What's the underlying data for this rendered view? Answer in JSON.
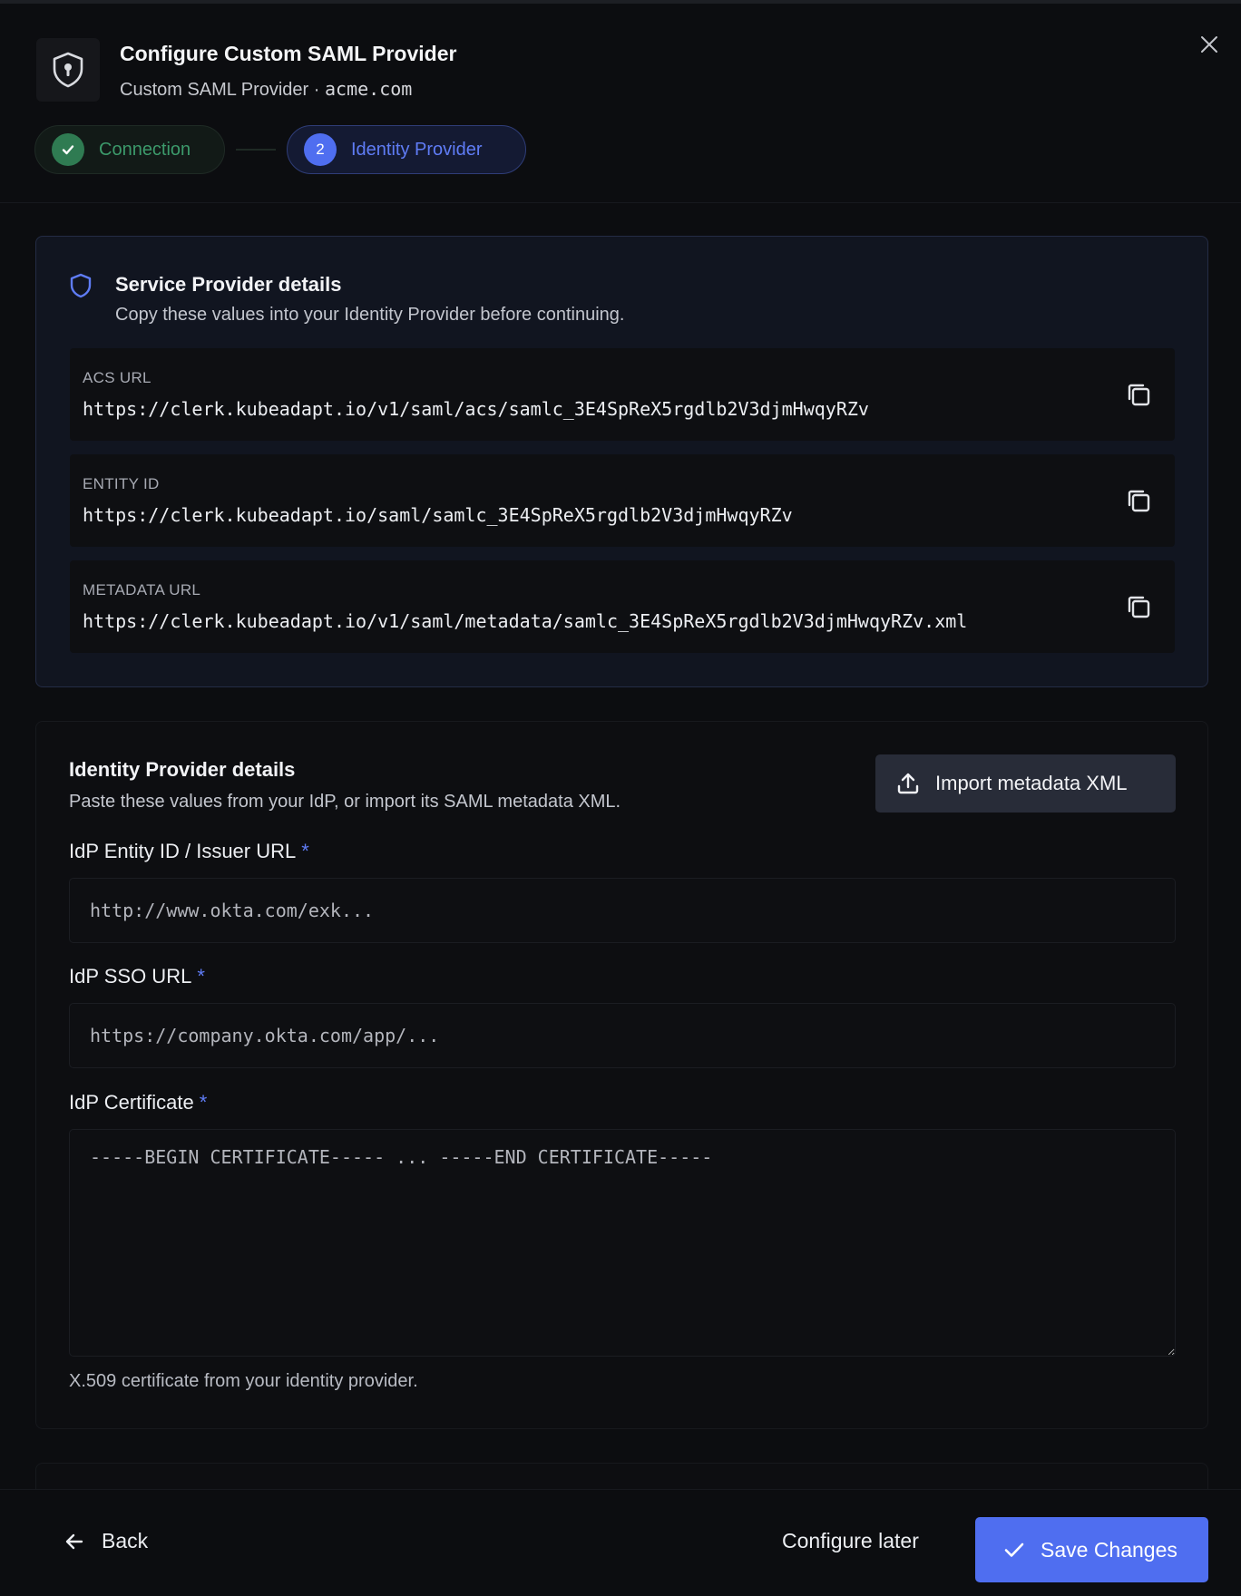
{
  "header": {
    "title": "Configure Custom SAML Provider",
    "subtitle_prefix": "Custom SAML Provider · ",
    "domain": "acme.com",
    "logo_icon": "shield-keyhole-icon",
    "close_icon": "close-icon"
  },
  "steps": [
    {
      "label": "Connection",
      "status": "complete",
      "icon": "check-icon"
    },
    {
      "number": "2",
      "label": "Identity Provider",
      "status": "active"
    }
  ],
  "service_provider": {
    "title": "Service Provider details",
    "description": "Copy these values into your Identity Provider before continuing.",
    "icon": "shield-icon",
    "rows": [
      {
        "label": "ACS URL",
        "value": "https://clerk.kubeadapt.io/v1/saml/acs/samlc_3E4SpReX5rgdlb2V3djmHwqyRZv"
      },
      {
        "label": "ENTITY ID",
        "value": "https://clerk.kubeadapt.io/saml/samlc_3E4SpReX5rgdlb2V3djmHwqyRZv"
      },
      {
        "label": "METADATA URL",
        "value": "https://clerk.kubeadapt.io/v1/saml/metadata/samlc_3E4SpReX5rgdlb2V3djmHwqyRZv.xml"
      }
    ]
  },
  "identity_provider": {
    "title": "Identity Provider details",
    "description": "Paste these values from your IdP, or import its SAML metadata XML.",
    "import_label": "Import metadata XML",
    "fields": {
      "entity_id": {
        "label": "IdP Entity ID / Issuer URL",
        "required_mark": "*",
        "placeholder": "http://www.okta.com/exk...",
        "value": ""
      },
      "sso_url": {
        "label": "IdP SSO URL",
        "required_mark": "*",
        "placeholder": "https://company.okta.com/app/...",
        "value": ""
      },
      "certificate": {
        "label": "IdP Certificate",
        "required_mark": "*",
        "placeholder": "-----BEGIN CERTIFICATE----- ... -----END CERTIFICATE-----",
        "value": "",
        "hint": "X.509 certificate from your identity provider."
      }
    }
  },
  "footer": {
    "back_label": "Back",
    "later_label": "Configure later",
    "save_label": "Save Changes"
  },
  "colors": {
    "accent": "#4f6ef0",
    "success": "#2f7b52",
    "background": "#0c0d10"
  }
}
